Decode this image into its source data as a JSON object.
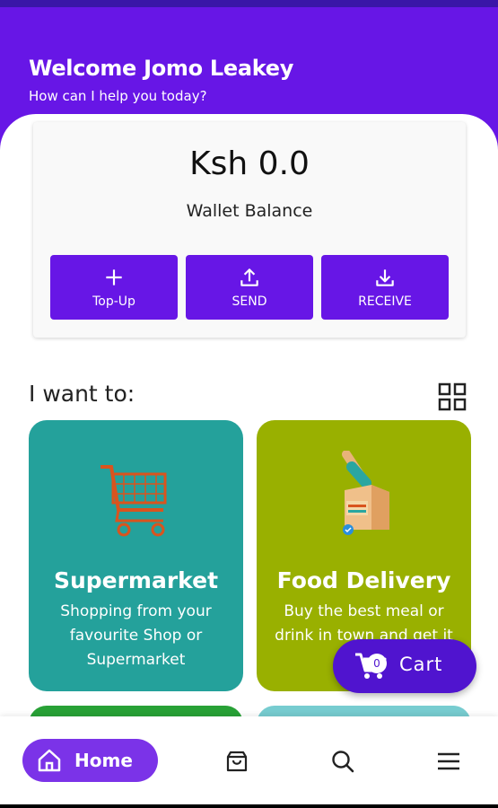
{
  "header": {
    "welcome": "Welcome Jomo Leakey",
    "subtitle": "How can I help you today?"
  },
  "wallet": {
    "balance": "Ksh 0.0",
    "label": "Wallet Balance",
    "actions": [
      {
        "label": "Top-Up",
        "icon": "plus-icon"
      },
      {
        "label": "SEND",
        "icon": "upload-icon"
      },
      {
        "label": "RECEIVE",
        "icon": "download-icon"
      }
    ]
  },
  "services": {
    "heading": "I want to:",
    "view_icon": "grid-view-icon",
    "tiles": [
      {
        "title": "Supermarket",
        "desc": "Shopping from your favourite Shop or Supermarket",
        "icon": "shopping-cart-icon",
        "color": "#24a19b"
      },
      {
        "title": "Food Delivery",
        "desc": "Buy the best meal or drink in town and get it",
        "icon": "food-bag-icon",
        "color": "#99b000"
      }
    ]
  },
  "cart": {
    "label": "Cart",
    "count": "0"
  },
  "nav": {
    "home_label": "Home",
    "items": [
      "home-icon",
      "bag-icon",
      "search-icon",
      "menu-icon"
    ]
  },
  "colors": {
    "primary": "#6716e6",
    "cart": "#5014cf",
    "home_pill": "#7b33e8"
  }
}
